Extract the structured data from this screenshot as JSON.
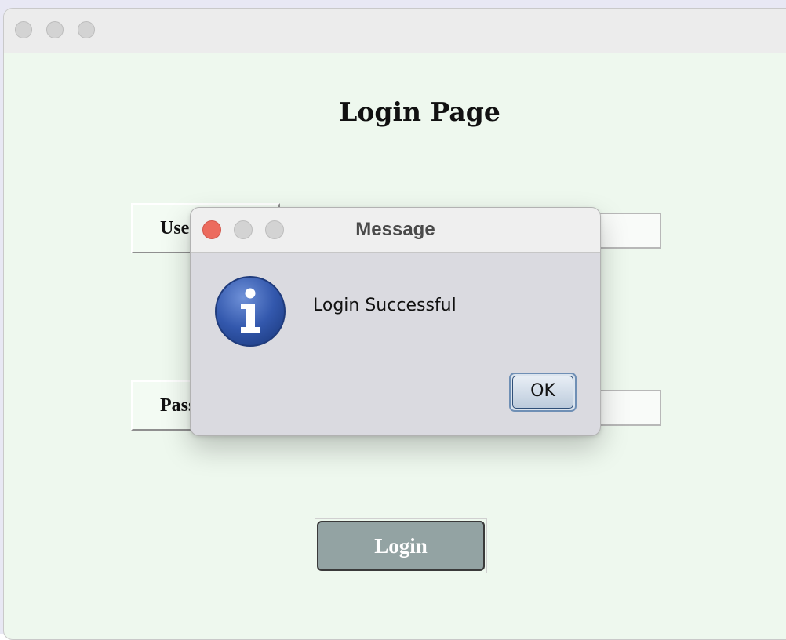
{
  "main_window": {
    "page_title": "Login Page",
    "username_label": "Username",
    "password_label": "Password",
    "login_button_label": "Login"
  },
  "dialog": {
    "title": "Message",
    "message": "Login Successful",
    "ok_label": "OK",
    "icon": "info-icon"
  },
  "colors": {
    "window_background": "#eef8ee",
    "dialog_background": "#dadae0",
    "close_button": "#ec6b5e",
    "login_button": "#93a3a3",
    "info_icon": "#2f54a6"
  }
}
